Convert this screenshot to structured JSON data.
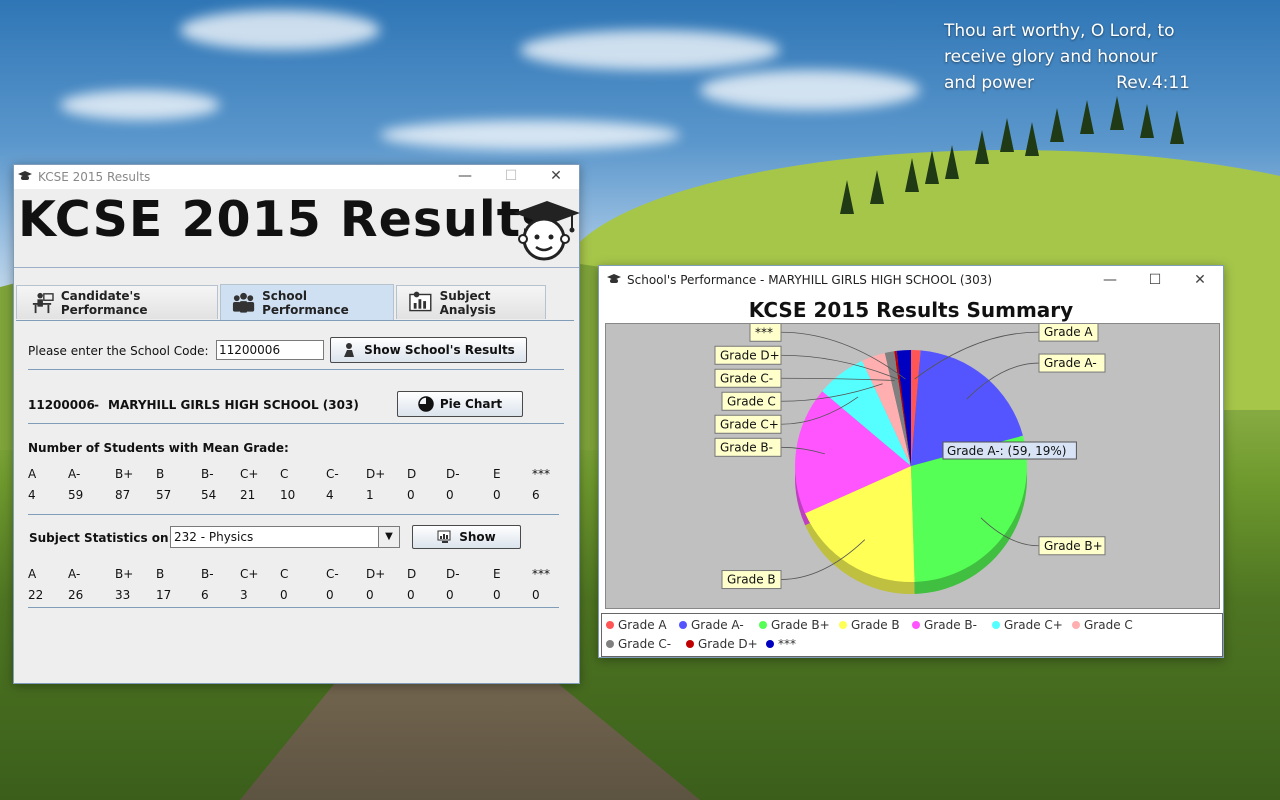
{
  "desktop": {
    "verse_lines": [
      "Thou art worthy, O Lord, to",
      "receive glory and honour",
      "and power"
    ],
    "verse_ref": "Rev.4:11"
  },
  "main_window": {
    "title": "KCSE 2015 Results",
    "banner_title": "KCSE 2015 Results",
    "tabs": [
      {
        "label": "Candidate's Performance",
        "icon": "student-desk-icon"
      },
      {
        "label": "School Performance",
        "icon": "group-icon"
      },
      {
        "label": "Subject Analysis",
        "icon": "chart-board-icon"
      }
    ],
    "school_code_label": "Please enter the School Code:",
    "school_code_value": "11200006",
    "show_results_button": "Show School's Results",
    "school_code_display": "11200006",
    "school_dash": "-",
    "school_name": "MARYHILL GIRLS HIGH SCHOOL (303)",
    "pie_chart_button": "Pie Chart",
    "mean_grade_heading": "Number of Students with Mean Grade:",
    "grade_headers": [
      "A",
      "A-",
      "B+",
      "B",
      "B-",
      "C+",
      "C",
      "C-",
      "D+",
      "D",
      "D-",
      "E",
      "***"
    ],
    "mean_grade_counts": [
      "4",
      "59",
      "87",
      "57",
      "54",
      "21",
      "10",
      "4",
      "1",
      "0",
      "0",
      "0",
      "6"
    ],
    "subject_label": "Subject Statistics on:",
    "subject_selected": "232 - Physics",
    "subject_show_button": "Show",
    "subject_counts": [
      "22",
      "26",
      "33",
      "17",
      "6",
      "3",
      "0",
      "0",
      "0",
      "0",
      "0",
      "0",
      "0"
    ]
  },
  "chart_window": {
    "title": "School's Performance - MARYHILL GIRLS HIGH SCHOOL (303)",
    "tooltip": "Grade A-: (59, 19%)"
  },
  "chart_data": {
    "type": "pie",
    "title": "KCSE 2015 Results Summary",
    "categories": [
      "Grade A",
      "Grade A-",
      "Grade B+",
      "Grade B",
      "Grade B-",
      "Grade C+",
      "Grade C",
      "Grade C-",
      "Grade D+",
      "***"
    ],
    "values": [
      4,
      59,
      87,
      57,
      54,
      21,
      10,
      4,
      1,
      6
    ],
    "colors": [
      "#ff5555",
      "#5555ff",
      "#55ff55",
      "#ffff55",
      "#ff55ff",
      "#55ffff",
      "#ffafaf",
      "#808080",
      "#c00000",
      "#0000c0"
    ],
    "legend_position": "bottom"
  }
}
